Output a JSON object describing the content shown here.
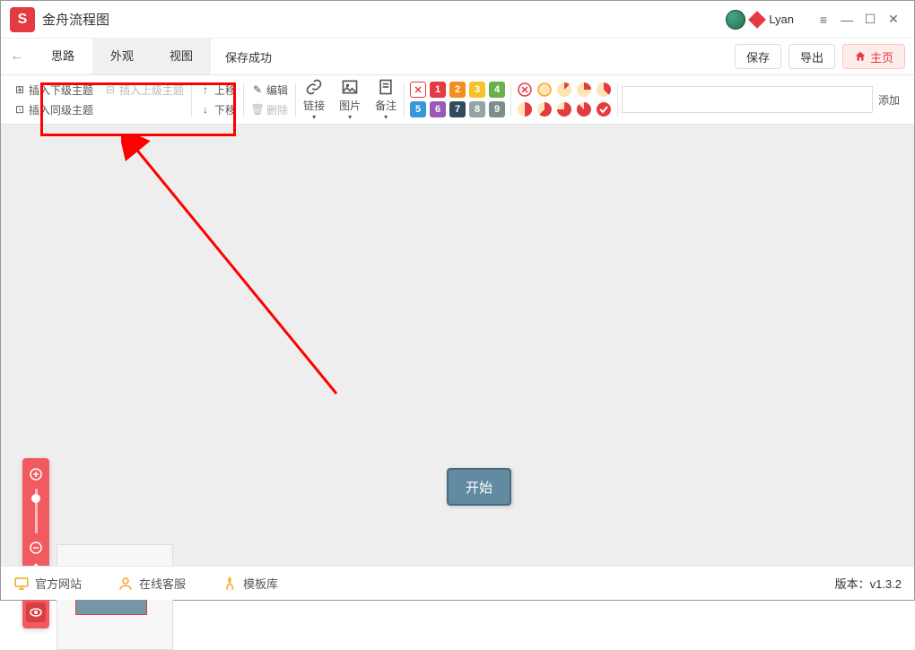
{
  "app": {
    "title": "金舟流程图"
  },
  "user": {
    "name": "Lyan"
  },
  "window": {
    "menu": "≡",
    "min": "—",
    "max": "☐",
    "close": "✕"
  },
  "menubar": {
    "back": "←",
    "tabs": [
      "思路",
      "外观",
      "视图"
    ],
    "save_status": "保存成功",
    "save": "保存",
    "export": "导出",
    "home": "主页"
  },
  "toolbar": {
    "insert_sub": "插入下级主题",
    "insert_parent": "插入上级主题",
    "insert_sibling": "插入同级主题",
    "move_up": "上移",
    "move_down": "下移",
    "edit": "编辑",
    "delete": "删除",
    "link": "链接",
    "image": "图片",
    "note": "备注",
    "badge_x": "✕",
    "badges_r1": [
      "1",
      "2",
      "3",
      "4"
    ],
    "badges_r2": [
      "5",
      "6",
      "7",
      "8",
      "9"
    ],
    "add": "添加"
  },
  "canvas": {
    "start": "开始"
  },
  "footer": {
    "website": "官方网站",
    "service": "在线客服",
    "templates": "模板库",
    "version_label": "版本：",
    "version": "v1.3.2"
  },
  "colors": {
    "badge_r1": [
      "#e43b42",
      "#f38f1e",
      "#f6c12a",
      "#6ab04c"
    ],
    "badge_r2": [
      "#3498db",
      "#9b59b6",
      "#34495e",
      "#95a5a6",
      "#7f8c8d"
    ]
  }
}
